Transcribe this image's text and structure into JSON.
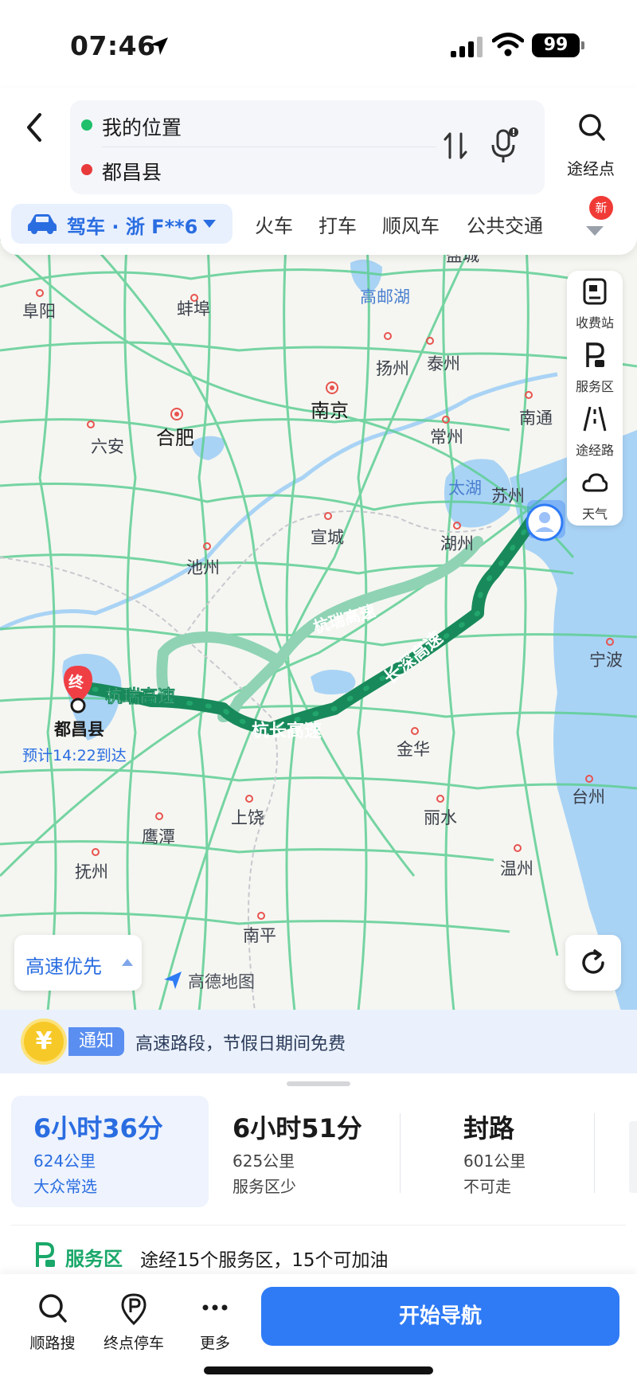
{
  "status_bar": {
    "time": "07:46",
    "battery": "99"
  },
  "header": {
    "origin": "我的位置",
    "destination": "都昌县",
    "waypoint_label": "途经点",
    "vehicle_mode": "驾车 · 浙 F**6",
    "modes": [
      "火车",
      "打车",
      "顺风车",
      "公共交通"
    ],
    "new_badge": "新",
    "colors": {
      "accent": "#2a6de1",
      "origin_dot": "#1fbf6b",
      "destination_dot": "#e83a3a"
    }
  },
  "map": {
    "cities": [
      "盐城",
      "阜阳",
      "蚌埠",
      "高邮湖",
      "扬州",
      "泰州",
      "南京",
      "合肥",
      "南通",
      "六安",
      "常州",
      "太湖",
      "苏州",
      "宣城",
      "湖州",
      "池州",
      "宁波",
      "金华",
      "台州",
      "上饶",
      "丽水",
      "鹰潭",
      "温州",
      "抚州",
      "南平"
    ],
    "route_labels": [
      "杭瑞高速",
      "杭瑞高速",
      "杭长高速",
      "长深高速"
    ],
    "end_marker": "终",
    "destination_name": "都昌县",
    "eta": "预计14:22到达",
    "tools": [
      {
        "icon": "toll-station-icon",
        "label": "收费站"
      },
      {
        "icon": "service-area-icon",
        "label": "服务区"
      },
      {
        "icon": "road-icon",
        "label": "途经路"
      },
      {
        "icon": "weather-icon",
        "label": "天气"
      }
    ],
    "preference": "高速优先",
    "brand": "高德地图"
  },
  "notice": {
    "coin": "¥",
    "tag": "通知",
    "text": "高速路段，节假日期间免费"
  },
  "routes": [
    {
      "time": "6小时36分",
      "distance": "624公里",
      "tag": "大众常选",
      "selected": true
    },
    {
      "time": "6小时51分",
      "distance": "625公里",
      "tag": "服务区少",
      "selected": false
    },
    {
      "time": "封路",
      "distance": "601公里",
      "tag": "不可走",
      "selected": false
    }
  ],
  "service": {
    "label": "服务区",
    "text": "途经15个服务区，15个可加油"
  },
  "bottom_bar": {
    "items": [
      {
        "icon": "search-icon",
        "label": "顺路搜"
      },
      {
        "icon": "parking-icon",
        "label": "终点停车"
      },
      {
        "icon": "more-icon",
        "label": "更多"
      }
    ],
    "start": "开始导航"
  }
}
